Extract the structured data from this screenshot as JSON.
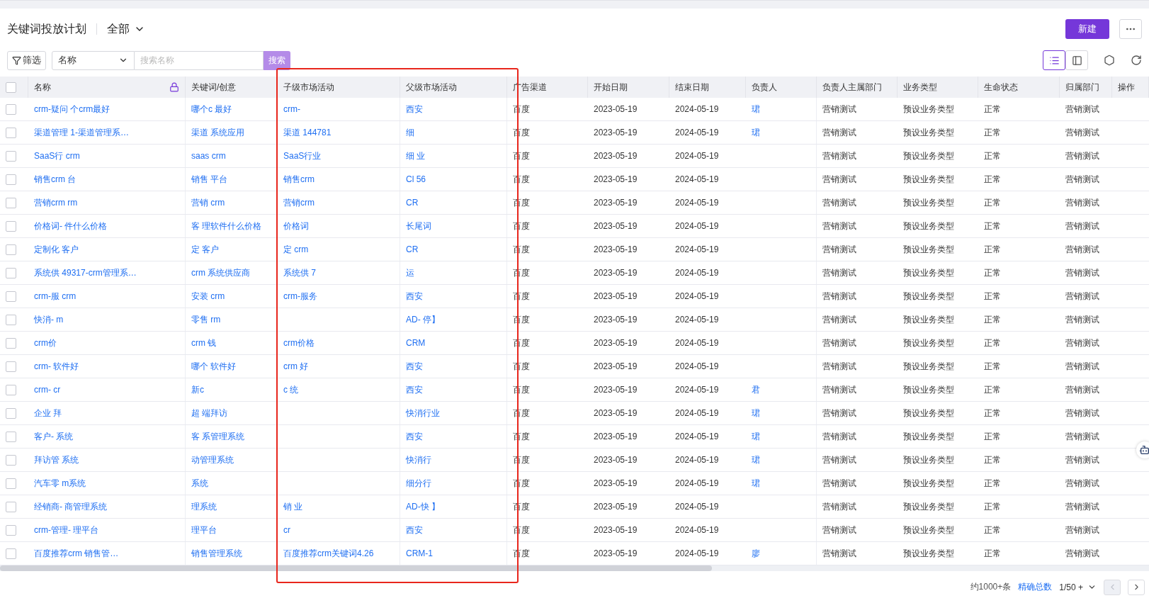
{
  "header": {
    "title": "关键词投放计划",
    "scope": "全部",
    "new_button": "新建"
  },
  "toolbar": {
    "filter_button": "筛选",
    "field_select": "名称",
    "search_placeholder": "搜索名称",
    "search_button": "搜索",
    "search_disabled": true,
    "views": [
      {
        "kind": "list",
        "selected": true
      },
      {
        "kind": "panel",
        "selected": false
      }
    ]
  },
  "table": {
    "select_all_checked": false,
    "columns": [
      {
        "label": "名称",
        "locked": true
      },
      {
        "label": "关键词/创意",
        "locked": false
      },
      {
        "label": "子级市场活动",
        "locked": false
      },
      {
        "label": "父级市场活动",
        "locked": false
      },
      {
        "label": "广告渠道",
        "locked": false
      },
      {
        "label": "开始日期",
        "locked": false
      },
      {
        "label": "结束日期",
        "locked": false
      },
      {
        "label": "负责人",
        "locked": false
      },
      {
        "label": "负责人主属部门",
        "locked": false
      },
      {
        "label": "业务类型",
        "locked": false
      },
      {
        "label": "生命状态",
        "locked": false
      },
      {
        "label": "归属部门",
        "locked": false
      },
      {
        "label": "操作",
        "locked": false
      }
    ],
    "rows": [
      {
        "checked": false,
        "name": "crm-疑问 个crm最好",
        "keyword": "哪个c 最好",
        "child": "crm-",
        "parent": "西安",
        "channel": "百度",
        "start": "2023-05-19",
        "end": "2024-05-19",
        "owner": "珺",
        "dept": "营销测试",
        "biz_type": "预设业务类型",
        "status": "正常",
        "owner_dept": "营销测试"
      },
      {
        "checked": false,
        "name": "渠道管理 1-渠道管理系…",
        "keyword": "渠道 系统应用",
        "child": "渠道 144781",
        "parent": "细",
        "channel": "百度",
        "start": "2023-05-19",
        "end": "2024-05-19",
        "owner": "珺",
        "dept": "营销测试",
        "biz_type": "预设业务类型",
        "status": "正常",
        "owner_dept": "营销测试"
      },
      {
        "checked": false,
        "name": "SaaS行 crm",
        "keyword": "saas crm",
        "child": "SaaS行业",
        "parent": "细 业",
        "channel": "百度",
        "start": "2023-05-19",
        "end": "2024-05-19",
        "dept": "营销测试",
        "biz_type": "预设业务类型",
        "status": "正常",
        "owner_dept": "营销测试"
      },
      {
        "checked": false,
        "name": "销售crm 台",
        "keyword": "销售 平台",
        "child": "销售crm",
        "parent": "Cl 56",
        "channel": "百度",
        "start": "2023-05-19",
        "end": "2024-05-19",
        "dept": "营销测试",
        "biz_type": "预设业务类型",
        "status": "正常",
        "owner_dept": "营销测试"
      },
      {
        "checked": false,
        "name": "营销crm rm",
        "keyword": "营销 crm",
        "child": "营销crm",
        "parent": "CR",
        "channel": "百度",
        "start": "2023-05-19",
        "end": "2024-05-19",
        "dept": "营销测试",
        "biz_type": "预设业务类型",
        "status": "正常",
        "owner_dept": "营销测试"
      },
      {
        "checked": false,
        "name": "价格词- 件什么价格",
        "keyword": "客 理软件什么价格",
        "child": "价格词",
        "parent": "长尾词",
        "channel": "百度",
        "start": "2023-05-19",
        "end": "2024-05-19",
        "dept": "营销测试",
        "biz_type": "预设业务类型",
        "status": "正常",
        "owner_dept": "营销测试"
      },
      {
        "checked": false,
        "name": "定制化 客户",
        "keyword": "定 客户",
        "child": "定 crm",
        "parent": "CR",
        "channel": "百度",
        "start": "2023-05-19",
        "end": "2024-05-19",
        "dept": "营销测试",
        "biz_type": "预设业务类型",
        "status": "正常",
        "owner_dept": "营销测试"
      },
      {
        "checked": false,
        "name": "系统供 49317-crm管理系…",
        "keyword": "crm 系统供应商",
        "child": "系统供 7",
        "parent": "运",
        "channel": "百度",
        "start": "2023-05-19",
        "end": "2024-05-19",
        "dept": "营销测试",
        "biz_type": "预设业务类型",
        "status": "正常",
        "owner_dept": "营销测试"
      },
      {
        "checked": false,
        "name": "crm-服 crm",
        "keyword": "安装 crm",
        "child": "crm-服务",
        "parent": "西安",
        "channel": "百度",
        "start": "2023-05-19",
        "end": "2024-05-19",
        "dept": "营销测试",
        "biz_type": "预设业务类型",
        "status": "正常",
        "owner_dept": "营销测试"
      },
      {
        "checked": false,
        "name": "快消- m",
        "keyword": "零售 rm",
        "parent": "AD- 停】",
        "channel": "百度",
        "start": "2023-05-19",
        "end": "2024-05-19",
        "dept": "营销测试",
        "biz_type": "预设业务类型",
        "status": "正常",
        "owner_dept": "营销测试"
      },
      {
        "checked": false,
        "name": "crm价",
        "keyword": "crm 钱",
        "child": "crm价格",
        "parent": "CRM",
        "channel": "百度",
        "start": "2023-05-19",
        "end": "2024-05-19",
        "dept": "营销测试",
        "biz_type": "预设业务类型",
        "status": "正常",
        "owner_dept": "营销测试"
      },
      {
        "checked": false,
        "name": "crm- 软件好",
        "keyword": "哪个 软件好",
        "child": "crm 好",
        "parent": "西安",
        "channel": "百度",
        "start": "2023-05-19",
        "end": "2024-05-19",
        "dept": "营销测试",
        "biz_type": "预设业务类型",
        "status": "正常",
        "owner_dept": "营销测试"
      },
      {
        "checked": false,
        "name": "crm- cr",
        "keyword": "新c",
        "child": "c 统",
        "parent": "西安",
        "channel": "百度",
        "start": "2023-05-19",
        "end": "2024-05-19",
        "owner": "君",
        "dept": "营销测试",
        "biz_type": "预设业务类型",
        "status": "正常",
        "owner_dept": "营销测试"
      },
      {
        "checked": false,
        "name": "企业 拜",
        "keyword": "超 端拜访",
        "parent": "快消行业",
        "channel": "百度",
        "start": "2023-05-19",
        "end": "2024-05-19",
        "owner": "珺",
        "dept": "营销测试",
        "biz_type": "预设业务类型",
        "status": "正常",
        "owner_dept": "营销测试"
      },
      {
        "checked": false,
        "name": "客户- 系统",
        "keyword": "客 系管理系统",
        "parent": "西安",
        "channel": "百度",
        "start": "2023-05-19",
        "end": "2024-05-19",
        "owner": "珺",
        "dept": "营销测试",
        "biz_type": "预设业务类型",
        "status": "正常",
        "owner_dept": "营销测试"
      },
      {
        "checked": false,
        "name": "拜访管 系统",
        "keyword": "动管理系统",
        "parent": "快消行",
        "channel": "百度",
        "start": "2023-05-19",
        "end": "2024-05-19",
        "owner": "珺",
        "dept": "营销测试",
        "biz_type": "预设业务类型",
        "status": "正常",
        "owner_dept": "营销测试"
      },
      {
        "checked": false,
        "name": "汽车零 m系统",
        "keyword": "系统",
        "parent": "细分行",
        "channel": "百度",
        "start": "2023-05-19",
        "end": "2024-05-19",
        "owner": "珺",
        "dept": "营销测试",
        "biz_type": "预设业务类型",
        "status": "正常",
        "owner_dept": "营销测试"
      },
      {
        "checked": false,
        "name": "经销商- 商管理系统",
        "keyword": "理系统",
        "child": "销 业",
        "parent": "AD-快 】",
        "channel": "百度",
        "start": "2023-05-19",
        "end": "2024-05-19",
        "dept": "营销测试",
        "biz_type": "预设业务类型",
        "status": "正常",
        "owner_dept": "营销测试"
      },
      {
        "checked": false,
        "name": "crm-管理- 理平台",
        "keyword": "理平台",
        "child": "cr",
        "parent": "西安",
        "channel": "百度",
        "start": "2023-05-19",
        "end": "2024-05-19",
        "dept": "营销测试",
        "biz_type": "预设业务类型",
        "status": "正常",
        "owner_dept": "营销测试"
      },
      {
        "checked": false,
        "name": "百度推荐crm 销售管…",
        "keyword": "销售管理系统",
        "child": "百度推荐crm关键词4.26",
        "parent": "CRM-1",
        "channel": "百度",
        "start": "2023-05-19",
        "end": "2024-05-19",
        "owner": "廖",
        "dept": "营销测试",
        "biz_type": "预设业务类型",
        "status": "正常",
        "owner_dept": "营销测试"
      }
    ]
  },
  "footer": {
    "total": "约1000+条",
    "exact_total_link": "精确总数",
    "page": "1/50 +",
    "prev_disabled": true
  }
}
